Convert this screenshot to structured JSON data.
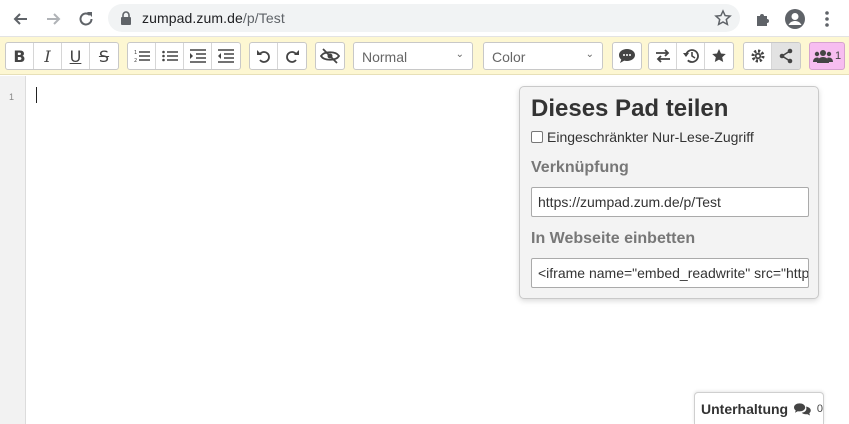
{
  "browser": {
    "url_host": "zumpad.zum.de",
    "url_path": "/p/Test"
  },
  "toolbar": {
    "heading_select": "Normal",
    "color_select": "Color",
    "users_count": "1"
  },
  "editor": {
    "line_number": "1"
  },
  "share_popup": {
    "title": "Dieses Pad teilen",
    "readonly_label": "Eingeschränkter Nur-Lese-Zugriff",
    "link_heading": "Verknüpfung",
    "link_value": "https://zumpad.zum.de/p/Test",
    "embed_heading": "In Webseite einbetten",
    "embed_value": "<iframe name=\"embed_readwrite\" src=\"https://zumpad.zum.de/p/Test"
  },
  "chat": {
    "label": "Unterhaltung",
    "count": "0"
  },
  "colors": {
    "toolbar_bg": "#fdf7d2",
    "users_accent": "#f7bdf0"
  }
}
